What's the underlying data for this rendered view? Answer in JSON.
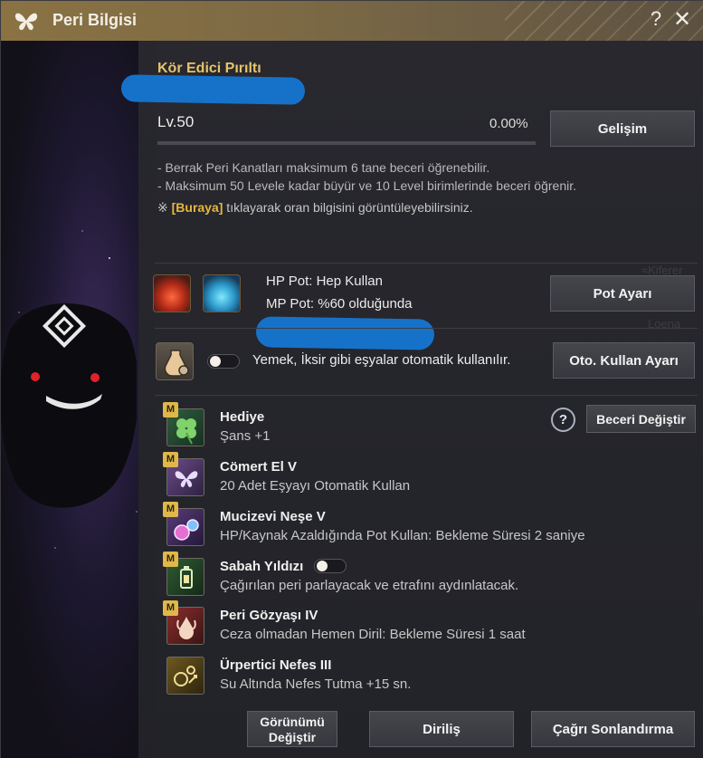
{
  "window": {
    "title": "Peri Bilgisi",
    "help_glyph": "?",
    "close_glyph": "✕"
  },
  "fairy": {
    "name": "Kör Edici Pırıltı",
    "level_label": "Lv.",
    "level": "50",
    "xp_percent_text": "0.00%",
    "xp_fraction": 0,
    "upgrade_button": "Gelişim"
  },
  "info": {
    "line1": "- Berrak Peri Kanatları maksimum 6 tane beceri öğrenebilir.",
    "line2": "- Maksimum 50 Levele kadar büyür ve 10 Level birimlerinde beceri öğrenir.",
    "note_prefix": "※ ",
    "note_link": "[Buraya]",
    "note_suffix": " tıklayarak oran bilgisini görüntüleyebilirsiniz."
  },
  "potions": {
    "hp_text": "HP Pot: Hep Kullan",
    "mp_text": "MP Pot: %60 olduğunda",
    "settings_button": "Pot Ayarı"
  },
  "auto_use": {
    "text": "Yemek, İksir gibi eşyalar otomatik kullanılır.",
    "toggle_on": false,
    "settings_button": "Oto. Kullan Ayarı"
  },
  "skills_header": {
    "help_glyph": "?",
    "change_button": "Beceri Değiştir"
  },
  "skills": [
    {
      "name": "Hediye",
      "desc": "Şans +1",
      "badge": "M"
    },
    {
      "name": "Cömert El V",
      "desc": "20 Adet Eşyayı Otomatik Kullan",
      "badge": "M"
    },
    {
      "name": "Mucizevi Neşe V",
      "desc": "HP/Kaynak Azaldığında Pot Kullan: Bekleme Süresi 2 saniye",
      "badge": "M"
    },
    {
      "name": "Sabah Yıldızı",
      "desc": "Çağırılan peri parlayacak ve etrafını aydınlatacak.",
      "badge": "M",
      "toggle_on": false
    },
    {
      "name": "Peri Gözyaşı IV",
      "desc": "Ceza olmadan Hemen Diril: Bekleme Süresi 1 saat",
      "badge": "M"
    },
    {
      "name": "Ürpertici Nefes III",
      "desc": "Su Altında Nefes Tutma +15 sn.",
      "badge": ""
    }
  ],
  "bottom": {
    "appearance_line1": "Görünümü",
    "appearance_line2": "Değiştir",
    "revive_button": "Diriliş",
    "end_summon_button": "Çağrı Sonlandırma"
  },
  "colors": {
    "accent_gold": "#e0b84a",
    "link_gold": "#e8b63e",
    "title_bar": "#8a7243",
    "redaction_blue": "#1672c9"
  }
}
